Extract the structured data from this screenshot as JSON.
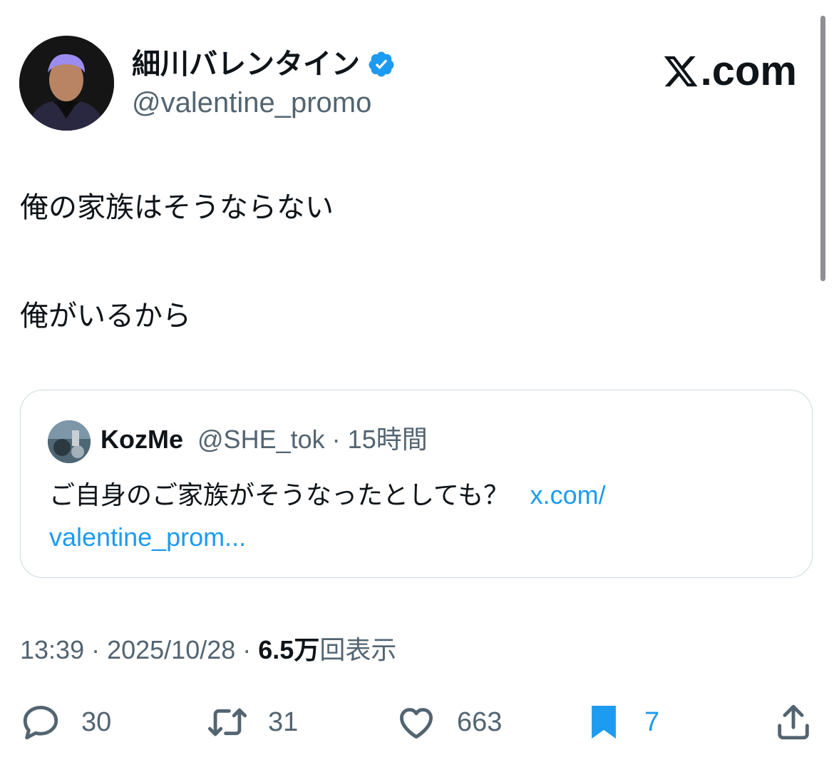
{
  "author": {
    "display_name": "細川バレンタイン",
    "handle": "@valentine_promo",
    "verified": true,
    "verified_color": "#1d9bf0"
  },
  "brand": {
    "text": ".com"
  },
  "tweet": {
    "lines": [
      "俺の家族はそうならない",
      "俺がいるから"
    ]
  },
  "quoted": {
    "name": "KozMe",
    "handle": "@SHE_tok",
    "separator": "·",
    "time": "15時間",
    "text": "ご自身のご家族がそうなったとしても？",
    "link_line1": "x.com/",
    "link_line2": "valentine_prom..."
  },
  "meta": {
    "time": "13:39",
    "sep1": " · ",
    "date": "2025/10/28",
    "sep2": " · ",
    "views": "6.5万",
    "views_label": "回表示"
  },
  "actions": {
    "replies": "30",
    "reposts": "31",
    "likes": "663",
    "bookmarks": "7",
    "accent": "#1d9bf0",
    "icons": [
      "reply-icon",
      "repost-icon",
      "like-icon",
      "bookmark-icon",
      "share-icon"
    ]
  }
}
